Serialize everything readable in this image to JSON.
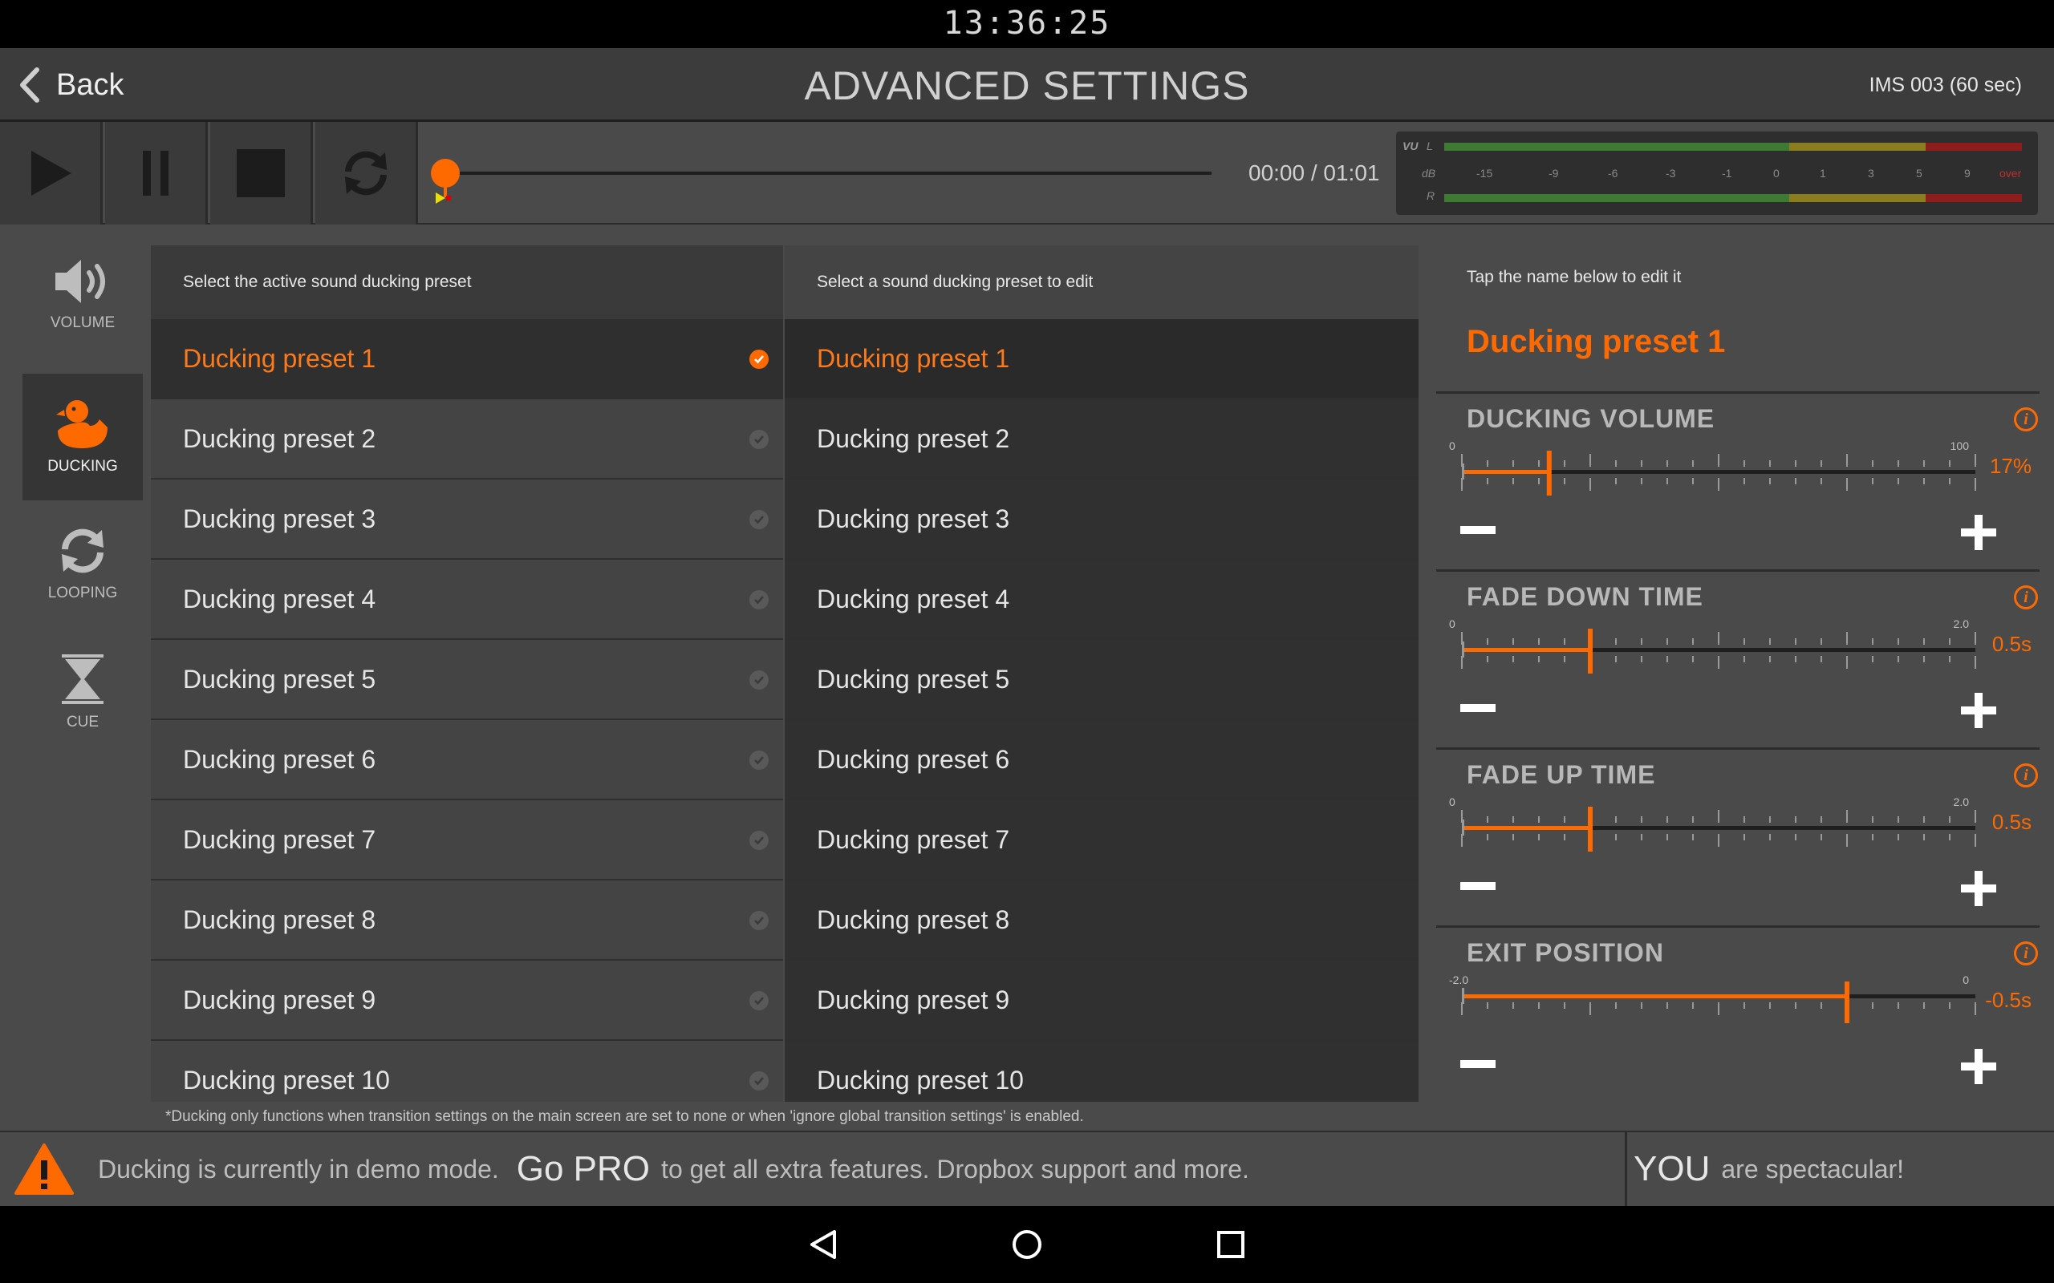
{
  "status_bar": {
    "clock": "13:36:25"
  },
  "header": {
    "back_label": "Back",
    "title": "ADVANCED SETTINGS",
    "track_name": "IMS 003 (60 sec)"
  },
  "transport": {
    "time_readout": "00:00 / 01:01",
    "progress": 0.0,
    "vu": {
      "label": "VU",
      "left_label": "L",
      "right_label": "R",
      "db_label": "dB",
      "scale": [
        "-15",
        "-9",
        "-6",
        "-3",
        "-1",
        "0",
        "1",
        "3",
        "5",
        "9",
        "over"
      ]
    }
  },
  "side_nav": {
    "items": [
      {
        "label": "VOLUME",
        "icon": "speaker-icon",
        "active": false
      },
      {
        "label": "DUCKING",
        "icon": "duck-icon",
        "active": true
      },
      {
        "label": "LOOPING",
        "icon": "loop-icon",
        "active": false
      },
      {
        "label": "CUE",
        "icon": "hourglass-icon",
        "active": false
      }
    ]
  },
  "active_list": {
    "heading": "Select the active sound ducking preset",
    "items": [
      "Ducking preset 1",
      "Ducking preset 2",
      "Ducking preset 3",
      "Ducking preset 4",
      "Ducking preset 5",
      "Ducking preset 6",
      "Ducking preset 7",
      "Ducking preset 8",
      "Ducking preset 9",
      "Ducking preset 10"
    ],
    "selected_index": 0
  },
  "edit_list": {
    "heading": "Select a sound ducking preset to edit",
    "items": [
      "Ducking preset 1",
      "Ducking preset 2",
      "Ducking preset 3",
      "Ducking preset 4",
      "Ducking preset 5",
      "Ducking preset 6",
      "Ducking preset 7",
      "Ducking preset 8",
      "Ducking preset 9",
      "Ducking preset 10"
    ],
    "selected_index": 0
  },
  "editor": {
    "heading": "Tap the name below  to edit it",
    "preset_name": "Ducking preset 1",
    "params": [
      {
        "title": "DUCKING VOLUME",
        "min_label": "0",
        "max_label": "100",
        "value_text": "17%",
        "fraction": 0.17,
        "ticks_above": true
      },
      {
        "title": "FADE DOWN TIME",
        "min_label": "0",
        "max_label": "2.0",
        "value_text": "0.5s",
        "fraction": 0.25,
        "ticks_above": true
      },
      {
        "title": "FADE UP TIME",
        "min_label": "0",
        "max_label": "2.0",
        "value_text": "0.5s",
        "fraction": 0.25,
        "ticks_above": true
      },
      {
        "title": "EXIT POSITION",
        "min_label": "-2.0",
        "max_label": "0",
        "value_text": "-0.5s",
        "fraction": 0.75,
        "ticks_above": false
      }
    ]
  },
  "footnote": "*Ducking only functions when transition settings on the main screen are set to none or when 'ignore global transition settings' is enabled.",
  "banner": {
    "demo_text": "Ducking is currently in demo mode.",
    "go_pro": "Go PRO",
    "pro_text": "to get all extra features. Dropbox support and more.",
    "you": "YOU",
    "spectacular": "are spectacular!"
  },
  "colors": {
    "accent": "#ff6a00",
    "panel": "#4a4a4a",
    "dark": "#303030"
  }
}
